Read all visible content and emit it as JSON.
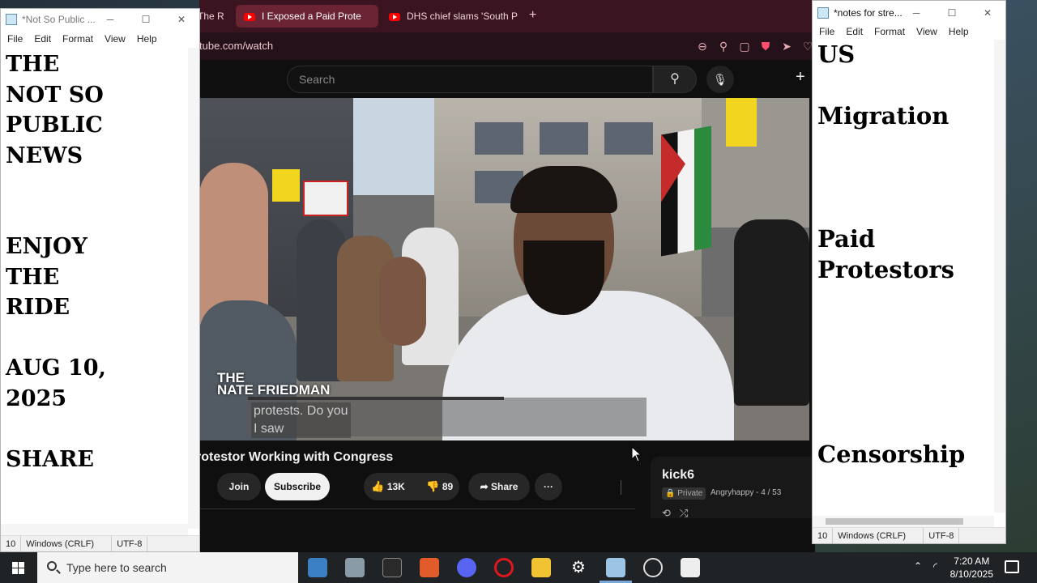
{
  "browser": {
    "tabs": [
      {
        "label": "The R"
      },
      {
        "label": "I Exposed a Paid Prote"
      },
      {
        "label": "DHS chief slams 'South P"
      }
    ],
    "new_tab": "+",
    "url": "tube.com/watch"
  },
  "youtube": {
    "search_placeholder": "Search",
    "video_title": "rotestor Working with Congress",
    "watermark_line1": "THE",
    "watermark_line2": "NATE FRIEDMAN",
    "caption_line1": "protests. Do you",
    "caption_line2": "I saw",
    "join_label": "Join",
    "subscribe_label": "Subscribe",
    "likes": "13K",
    "dislikes": "89",
    "share_label": "Share",
    "more_label": "···",
    "playlist": {
      "title": "kick6",
      "privacy": "Private",
      "owner": "Angryhappy - 4 / 53"
    }
  },
  "notepad_left": {
    "title": "*Not So Public ...",
    "menu": [
      "File",
      "Edit",
      "Format",
      "View",
      "Help"
    ],
    "lines": [
      "THE",
      "NOT SO",
      "PUBLIC",
      "NEWS",
      "",
      "",
      "ENJOY",
      "THE",
      "RIDE",
      "",
      "AUG 10,",
      "2025",
      "",
      "SHARE"
    ],
    "status_pos": "10",
    "status_eol": "Windows (CRLF)",
    "status_enc": "UTF-8"
  },
  "notepad_right": {
    "title": "*notes for stre...",
    "menu": [
      "File",
      "Edit",
      "Format",
      "View",
      "Help"
    ],
    "lines": [
      "US",
      "",
      "Migration",
      "",
      "",
      "",
      "Paid",
      "Protestors",
      "",
      "",
      "",
      "",
      "",
      "Censorship"
    ],
    "status_pos": "10",
    "status_eol": "Windows (CRLF)",
    "status_enc": "UTF-8"
  },
  "taskbar": {
    "search_placeholder": "Type here to search",
    "time": "7:20 AM",
    "date": "8/10/2025"
  }
}
